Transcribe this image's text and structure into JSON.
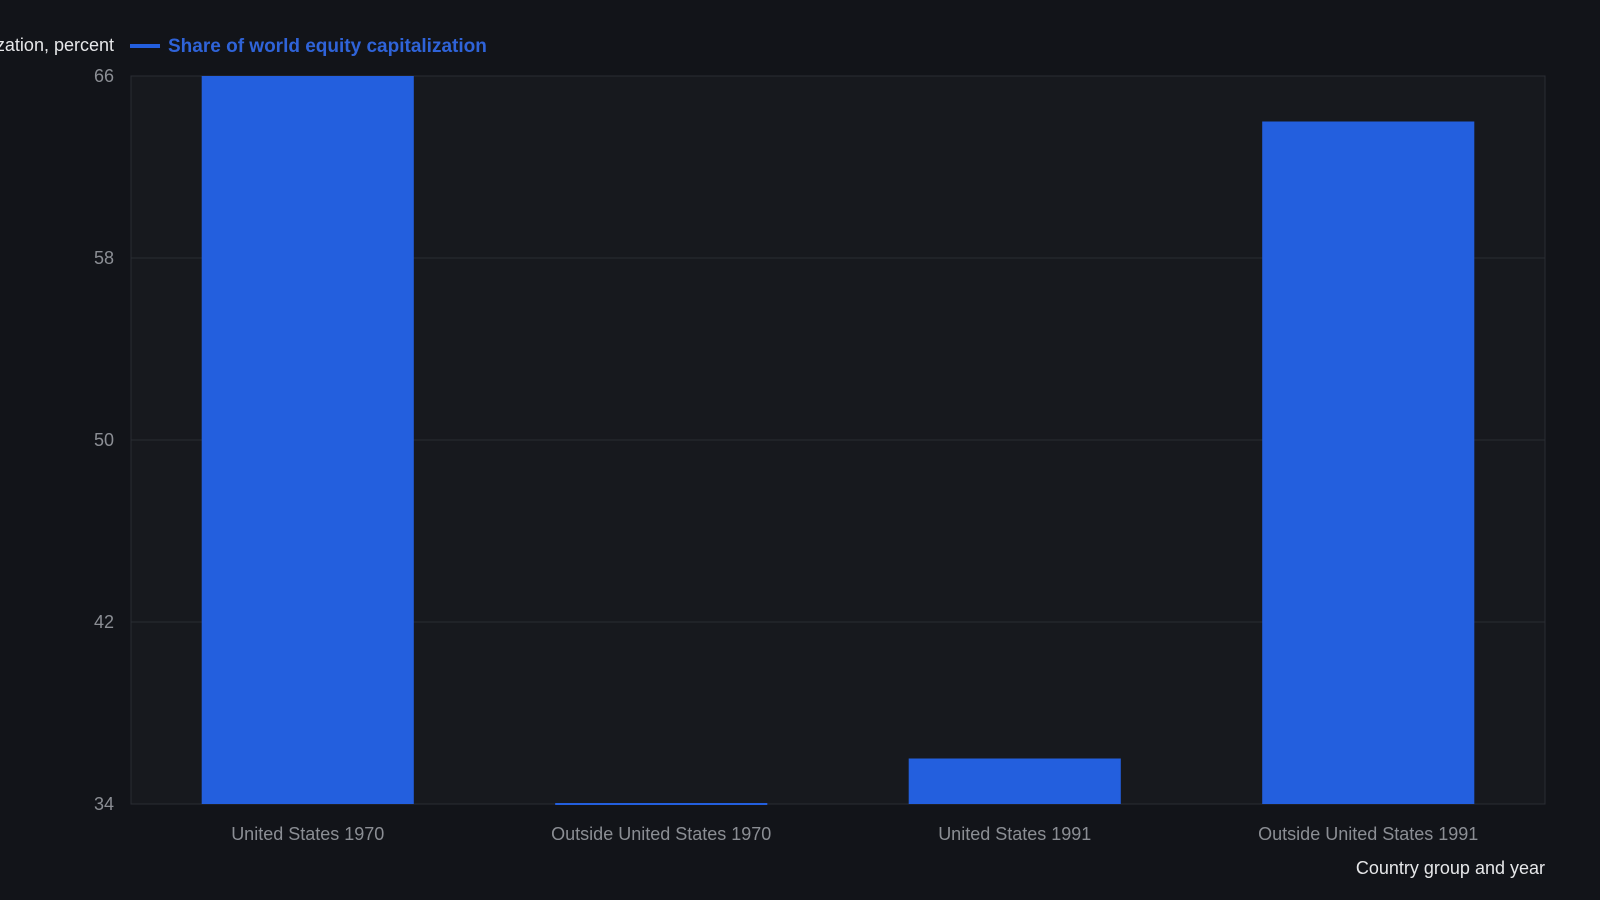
{
  "colors": {
    "background": "#121419",
    "plot_background": "#17191e",
    "bar": "#235FDE",
    "grid": "#2a2d33",
    "tick_text": "#8b8e94",
    "axis_title_text": "#e6e7e9",
    "legend_text": "#2f63d8"
  },
  "chart_data": {
    "type": "bar",
    "title": "",
    "ylabel": "Share of world equity capitalization, percent",
    "xlabel": "Country group and year",
    "categories": [
      "United States 1970",
      "Outside United States 1970",
      "United States 1991",
      "Outside United States 1991"
    ],
    "series": [
      {
        "name": "Share of world equity capitalization",
        "values": [
          66,
          34,
          36,
          64
        ]
      }
    ],
    "ylim": [
      34,
      66
    ],
    "yticks": [
      "34",
      "42",
      "50",
      "58",
      "66"
    ],
    "grid": true,
    "legend": "top-left"
  }
}
